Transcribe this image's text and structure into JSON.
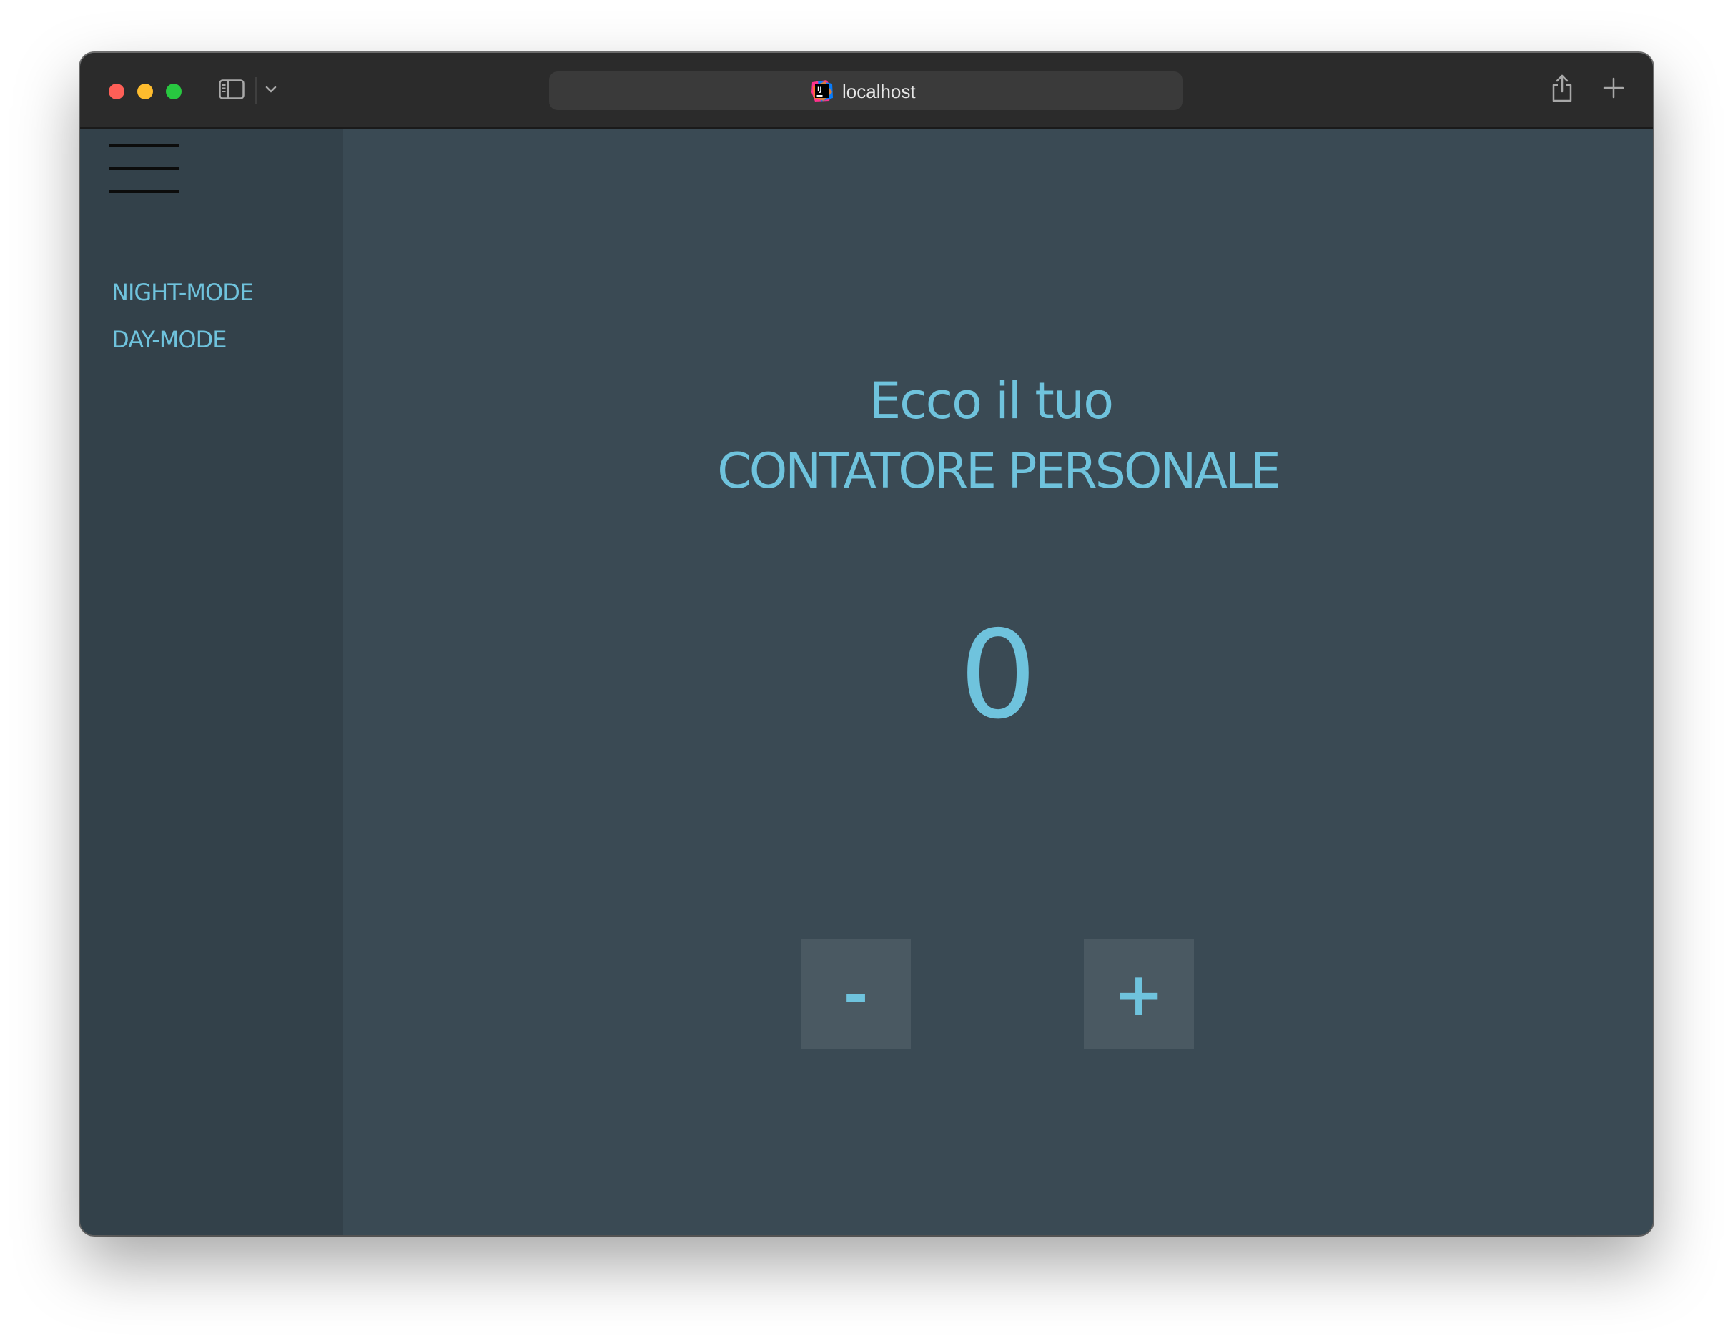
{
  "browser": {
    "url": "localhost",
    "favicon": "intellij-icon",
    "icons": {
      "sidebar_toggle": "sidebar-toggle-icon",
      "chevron": "chevron-down-icon",
      "share": "share-icon",
      "new_tab": "new-tab-icon"
    },
    "traffic_colors": {
      "close": "#fe5f57",
      "minimize": "#febc2e",
      "maximize": "#28c840"
    }
  },
  "sidebar": {
    "menu_icon": "hamburger-menu-icon",
    "links": [
      {
        "label": "NIGHT-MODE"
      },
      {
        "label": "DAY-MODE"
      }
    ]
  },
  "main": {
    "heading_line1": "Ecco il tuo",
    "heading_line2": "CONTATORE PERSONALE",
    "counter_value": "0",
    "decrement_label": "-",
    "increment_label": "+"
  },
  "colors": {
    "accent": "#6fc3dd",
    "background": "#3a4a54",
    "sidebar_bg": "#33414a",
    "button_bg": "#4a5962"
  }
}
